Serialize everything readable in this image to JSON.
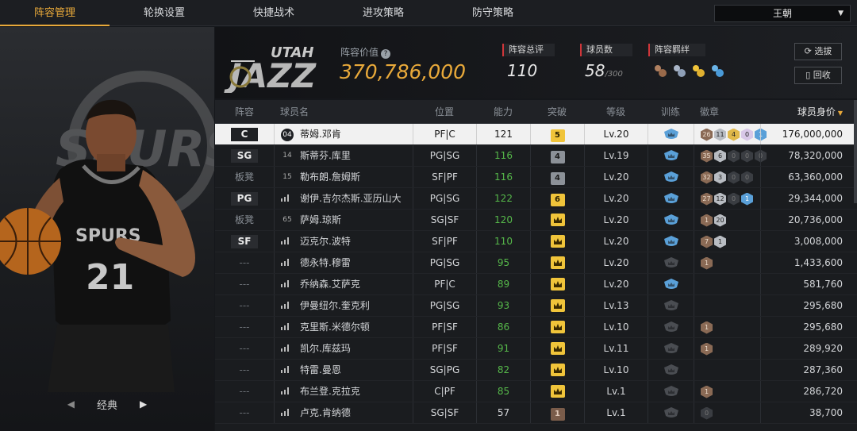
{
  "tabs": [
    "阵容管理",
    "轮换设置",
    "快捷战术",
    "进攻策略",
    "防守策略"
  ],
  "user": {
    "name": "王朝"
  },
  "left": {
    "mode_label": "经典",
    "player_jersey": "21",
    "team_wordmark": "SPURS"
  },
  "header": {
    "value_label": "阵容价值",
    "value": "370,786,000",
    "rating_label": "阵容总评",
    "rating": "110",
    "count_label": "球员数",
    "count": "58",
    "count_total": "/300",
    "bond_label": "阵容羁绊",
    "btn_select": "选拔",
    "btn_recycle": "回收"
  },
  "columns": [
    "阵容",
    "球员名",
    "位置",
    "能力",
    "突破",
    "等级",
    "训练",
    "徽章",
    "球员身价"
  ],
  "rows": [
    {
      "slot": "C",
      "slot_type": "boxed",
      "jersey": "04",
      "name": "蒂姆.邓肯",
      "pos": "PF|C",
      "ability": "121",
      "brk": "5",
      "brk_type": "gold",
      "level": "Lv.20",
      "train": "on",
      "badges": [
        [
          "26",
          "b"
        ],
        [
          "11",
          "s"
        ],
        [
          "4",
          "g"
        ],
        [
          "0",
          "p"
        ],
        [
          "1",
          "bl"
        ]
      ],
      "salary": "176,000,000"
    },
    {
      "slot": "SG",
      "slot_type": "boxed",
      "jersey": "14",
      "name": "斯蒂芬.库里",
      "pos": "PG|SG",
      "ability": "116",
      "brk": "4",
      "brk_type": "grey",
      "level": "Lv.19",
      "train": "on",
      "badges": [
        [
          "35",
          "b"
        ],
        [
          "6",
          "s"
        ],
        [
          "0",
          "dk"
        ],
        [
          "0",
          "dk"
        ],
        [
          "0",
          "dk"
        ]
      ],
      "salary": "78,320,000"
    },
    {
      "slot": "板凳",
      "slot_type": "bench",
      "jersey": "15",
      "name": "勒布朗.詹姆斯",
      "pos": "SF|PF",
      "ability": "116",
      "brk": "4",
      "brk_type": "grey",
      "level": "Lv.20",
      "train": "on",
      "badges": [
        [
          "32",
          "b"
        ],
        [
          "3",
          "s"
        ],
        [
          "0",
          "dk"
        ],
        [
          "0",
          "dk"
        ]
      ],
      "salary": "63,360,000"
    },
    {
      "slot": "PG",
      "slot_type": "boxed",
      "jersey": "",
      "name": "谢伊.吉尔杰斯.亚历山大",
      "pos": "PG|SG",
      "ability": "122",
      "brk": "6",
      "brk_type": "gold",
      "level": "Lv.20",
      "train": "on",
      "badges": [
        [
          "27",
          "b"
        ],
        [
          "12",
          "s"
        ],
        [
          "0",
          "dk"
        ],
        [
          "1",
          "bl"
        ]
      ],
      "salary": "29,344,000"
    },
    {
      "slot": "板凳",
      "slot_type": "bench",
      "jersey": "65",
      "name": "萨姆.琼斯",
      "pos": "SG|SF",
      "ability": "120",
      "brk": "",
      "brk_type": "crown",
      "level": "Lv.20",
      "train": "on",
      "badges": [
        [
          "1",
          "b"
        ],
        [
          "20",
          "s"
        ]
      ],
      "salary": "20,736,000"
    },
    {
      "slot": "SF",
      "slot_type": "boxed",
      "jersey": "",
      "name": "迈克尔.波特",
      "pos": "SF|PF",
      "ability": "110",
      "brk": "",
      "brk_type": "crown",
      "level": "Lv.20",
      "train": "on",
      "badges": [
        [
          "7",
          "b"
        ],
        [
          "1",
          "s"
        ]
      ],
      "salary": "3,008,000"
    },
    {
      "slot": "---",
      "slot_type": "none",
      "jersey": "",
      "name": "德永特.穆雷",
      "pos": "PG|SG",
      "ability": "95",
      "brk": "",
      "brk_type": "crown",
      "level": "Lv.20",
      "train": "off",
      "badges": [
        [
          "1",
          "b"
        ]
      ],
      "salary": "1,433,600"
    },
    {
      "slot": "---",
      "slot_type": "none",
      "jersey": "",
      "name": "乔纳森.艾萨克",
      "pos": "PF|C",
      "ability": "89",
      "brk": "",
      "brk_type": "crown",
      "level": "Lv.20",
      "train": "on",
      "badges": [],
      "salary": "581,760"
    },
    {
      "slot": "---",
      "slot_type": "none",
      "jersey": "",
      "name": "伊曼纽尔.奎克利",
      "pos": "PG|SG",
      "ability": "93",
      "brk": "",
      "brk_type": "crown",
      "level": "Lv.13",
      "train": "off",
      "badges": [],
      "salary": "295,680"
    },
    {
      "slot": "---",
      "slot_type": "none",
      "jersey": "",
      "name": "克里斯.米德尔顿",
      "pos": "PF|SF",
      "ability": "86",
      "brk": "",
      "brk_type": "crown",
      "level": "Lv.10",
      "train": "off",
      "badges": [
        [
          "1",
          "b"
        ]
      ],
      "salary": "295,680"
    },
    {
      "slot": "---",
      "slot_type": "none",
      "jersey": "",
      "name": "凯尔.库兹玛",
      "pos": "PF|SF",
      "ability": "91",
      "brk": "",
      "brk_type": "crown",
      "level": "Lv.11",
      "train": "off",
      "badges": [
        [
          "1",
          "b"
        ]
      ],
      "salary": "289,920"
    },
    {
      "slot": "---",
      "slot_type": "none",
      "jersey": "",
      "name": "特雷.曼恩",
      "pos": "SG|PG",
      "ability": "82",
      "brk": "",
      "brk_type": "crown",
      "level": "Lv.10",
      "train": "off",
      "badges": [],
      "salary": "287,360"
    },
    {
      "slot": "---",
      "slot_type": "none",
      "jersey": "",
      "name": "布兰登.克拉克",
      "pos": "C|PF",
      "ability": "85",
      "brk": "",
      "brk_type": "crown",
      "level": "Lv.1",
      "train": "off",
      "badges": [
        [
          "1",
          "b"
        ]
      ],
      "salary": "286,720"
    },
    {
      "slot": "---",
      "slot_type": "none",
      "jersey": "",
      "name": "卢克.肯纳德",
      "pos": "SG|SF",
      "ability": "57",
      "brk": "1",
      "brk_type": "bronze",
      "level": "Lv.1",
      "train": "off",
      "badges": [
        [
          "0",
          "dk"
        ]
      ],
      "salary": "38,700"
    }
  ]
}
